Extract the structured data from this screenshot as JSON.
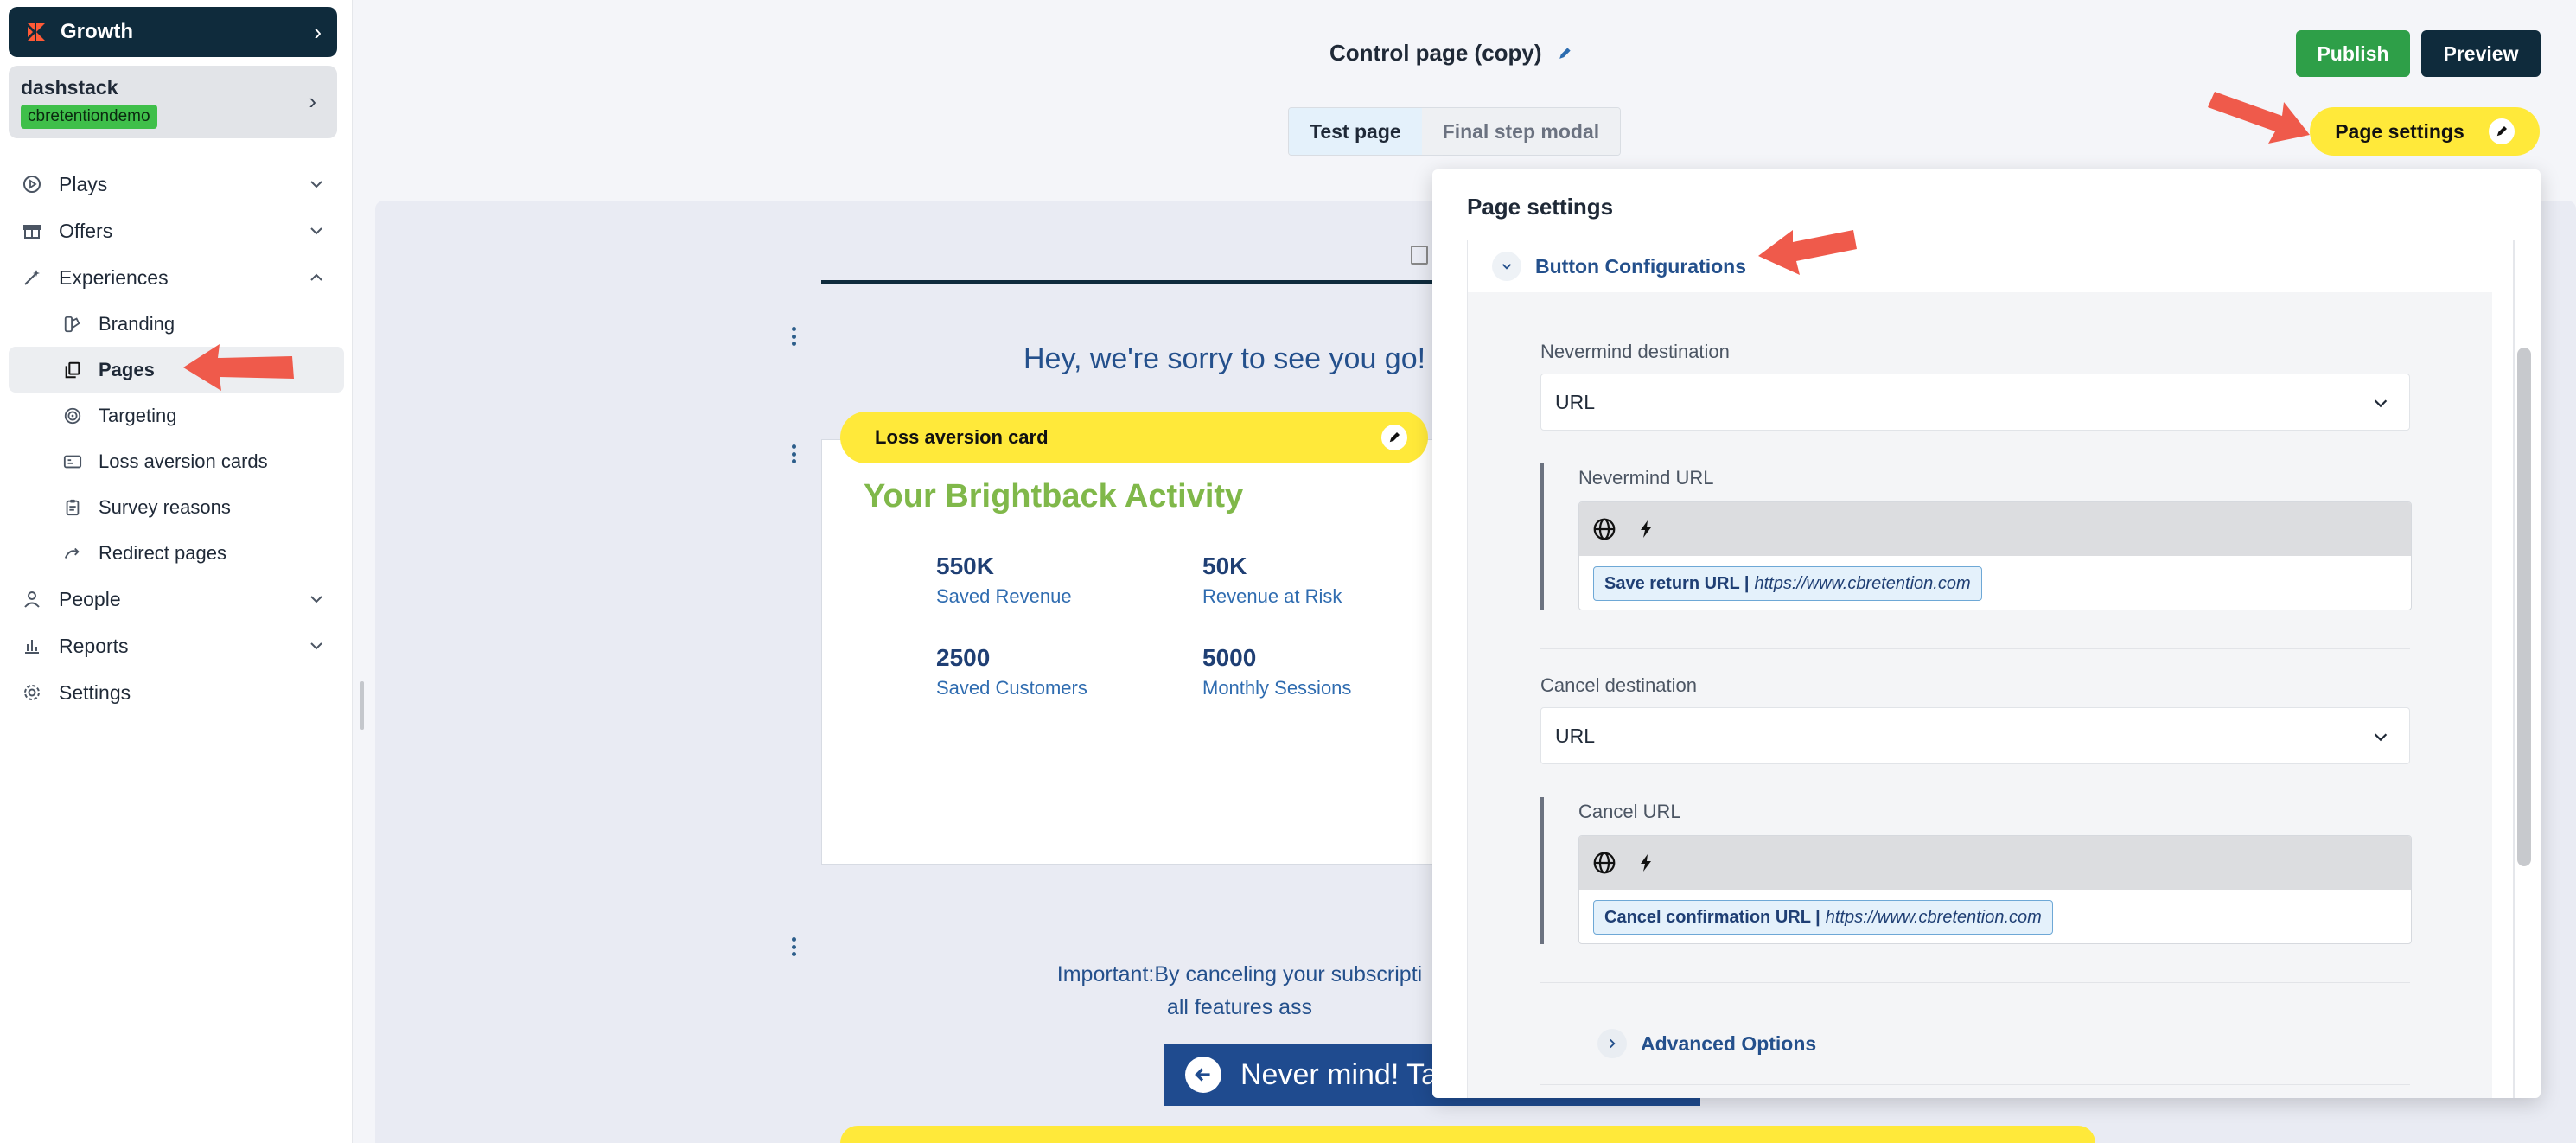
{
  "sidebar": {
    "org_name": "Growth",
    "account_name": "dashstack",
    "account_badge": "cbretentiondemo",
    "nav": [
      {
        "label": "Plays"
      },
      {
        "label": "Offers"
      },
      {
        "label": "Experiences"
      }
    ],
    "sub": [
      {
        "label": "Branding"
      },
      {
        "label": "Pages"
      },
      {
        "label": "Targeting"
      },
      {
        "label": "Loss aversion cards"
      },
      {
        "label": "Survey reasons"
      },
      {
        "label": "Redirect pages"
      }
    ],
    "nav2": [
      {
        "label": "People"
      },
      {
        "label": "Reports"
      },
      {
        "label": "Settings"
      }
    ]
  },
  "header": {
    "title": "Control page (copy)",
    "publish": "Publish",
    "preview": "Preview",
    "tabs": [
      {
        "label": "Test page"
      },
      {
        "label": "Final step modal"
      }
    ],
    "page_settings": "Page settings"
  },
  "canvas": {
    "sorry": "Hey, we're sorry to see you go!",
    "loss_card_label": "Loss aversion card",
    "activity_title": "Your Brightback Activity",
    "stats": [
      {
        "value": "550K",
        "label": "Saved Revenue"
      },
      {
        "value": "50K",
        "label": "Revenue at Risk"
      },
      {
        "value": "2500",
        "label": "Saved Customers"
      },
      {
        "value": "5000",
        "label": "Monthly Sessions"
      }
    ],
    "important_l1": "Important:By canceling your subscripti",
    "important_l2": "all features ass",
    "never_mind": "Never mind! Tak"
  },
  "panel": {
    "title": "Page settings",
    "section": "Button Configurations",
    "nevermind_dest_label": "Nevermind destination",
    "nevermind_dest_value": "URL",
    "nevermind_url_label": "Nevermind URL",
    "nevermind_token_bold": "Save return URL |",
    "nevermind_token_url": "https://www.cbretention.com",
    "cancel_dest_label": "Cancel destination",
    "cancel_dest_value": "URL",
    "cancel_url_label": "Cancel URL",
    "cancel_token_bold": "Cancel confirmation URL |",
    "cancel_token_url": "https://www.cbretention.com",
    "advanced": "Advanced Options"
  },
  "colors": {
    "brand_dark": "#0f2b3c",
    "publish_green": "#2e9f48",
    "highlight_yellow": "#ffe93a",
    "annotation_red": "#ef5a4b",
    "link_blue": "#24508c"
  }
}
